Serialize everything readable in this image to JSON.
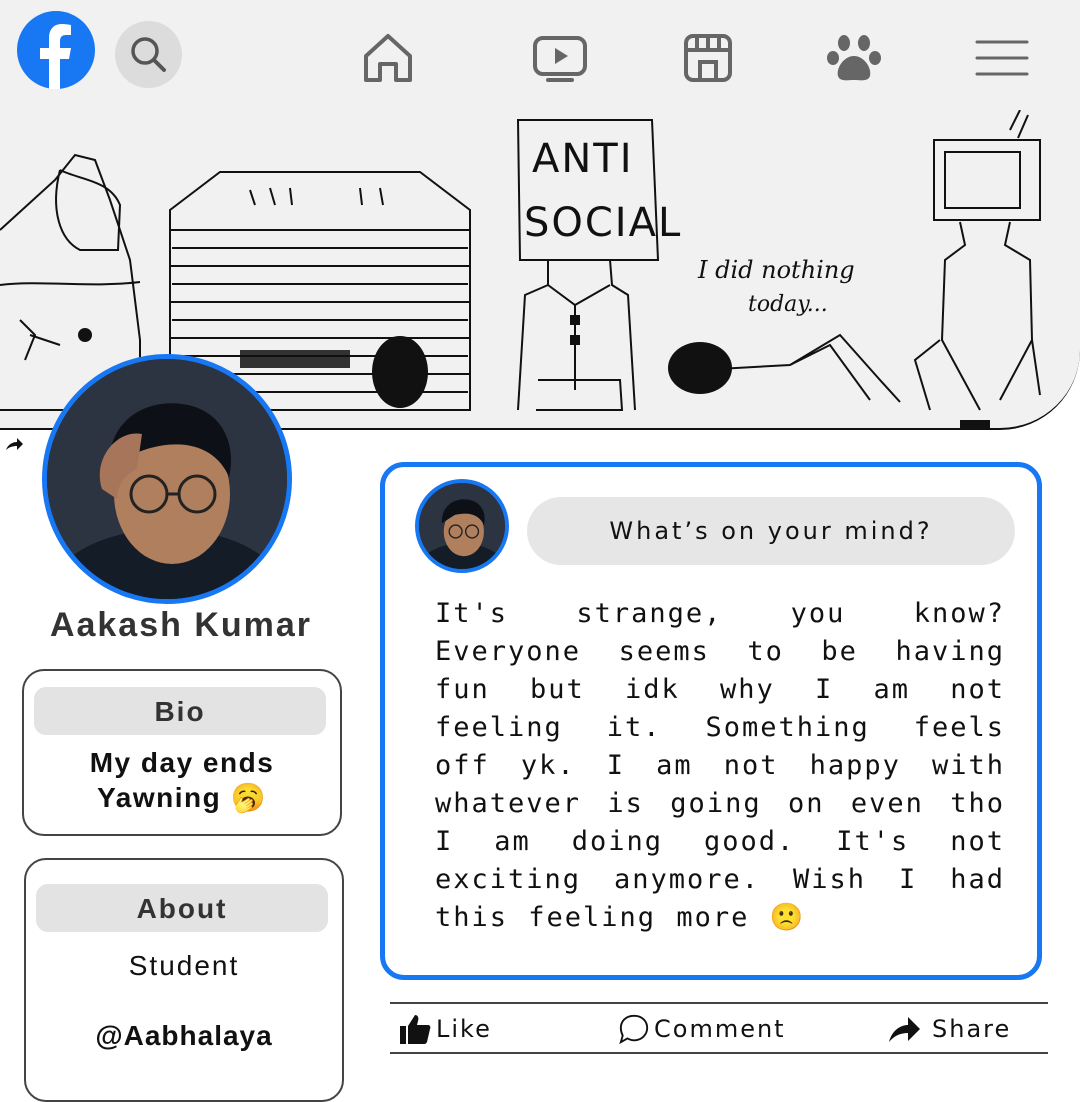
{
  "nav": {
    "icons": [
      "facebook-logo",
      "search-icon",
      "home-icon",
      "video-icon",
      "marketplace-icon",
      "paw-icon",
      "menu-icon"
    ],
    "brand_color": "#1877f2"
  },
  "cover": {
    "sign_line1": "ANTI",
    "sign_line2": "SOCIAL",
    "caption_line1": "I did nothing",
    "caption_line2": "today..."
  },
  "profile": {
    "name": "Aakash Kumar"
  },
  "bio": {
    "heading": "Bio",
    "line1": "My day ends",
    "line2": "Yawning 🥱"
  },
  "about": {
    "heading": "About",
    "occupation": "Student",
    "handle": "@Aabhalaya"
  },
  "post": {
    "prompt": "What’s on your mind?",
    "text": "It's strange, you know? Everyone seems to be having fun but idk why I am not feeling it. Something feels off yk. I am not happy with whatever is going on even tho I am doing good. It's not exciting anymore. Wish I had this feeling more 🙁"
  },
  "actions": {
    "like": "Like",
    "comment": "Comment",
    "share": "Share"
  }
}
